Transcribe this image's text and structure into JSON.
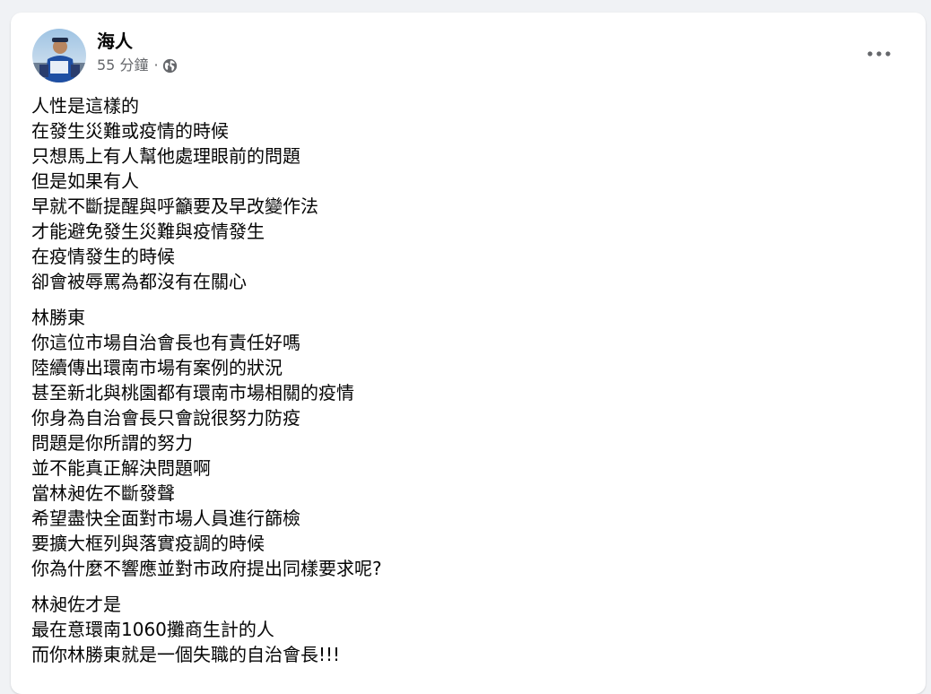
{
  "post": {
    "author_name": "海人",
    "timestamp": "55 分鐘",
    "separator": "·",
    "privacy_icon": "globe-icon",
    "more_icon": "more-horizontal-icon",
    "paragraphs": [
      [
        "人性是這樣的",
        "在發生災難或疫情的時候",
        "只想馬上有人幫他處理眼前的問題",
        "但是如果有人",
        "早就不斷提醒與呼籲要及早改變作法",
        "才能避免發生災難與疫情發生",
        "在疫情發生的時候",
        "卻會被辱罵為都沒有在關心"
      ],
      [
        "林勝東",
        "你這位市場自治會長也有責任好嗎",
        "陸續傳出環南市場有案例的狀況",
        "甚至新北與桃園都有環南市場相關的疫情",
        "你身為自治會長只會說很努力防疫",
        "問題是你所謂的努力",
        "並不能真正解決問題啊",
        "當林昶佐不斷發聲",
        "希望盡快全面對市場人員進行篩檢",
        "要擴大框列與落實疫調的時候",
        "你為什麼不響應並對市政府提出同樣要求呢?"
      ],
      [
        "林昶佐才是",
        "最在意環南1060攤商生計的人",
        "而你林勝東就是一個失職的自治會長!!!"
      ]
    ]
  },
  "colors": {
    "page_bg": "#f0f2f5",
    "card_bg": "#ffffff",
    "text_primary": "#050505",
    "text_secondary": "#65676b"
  }
}
